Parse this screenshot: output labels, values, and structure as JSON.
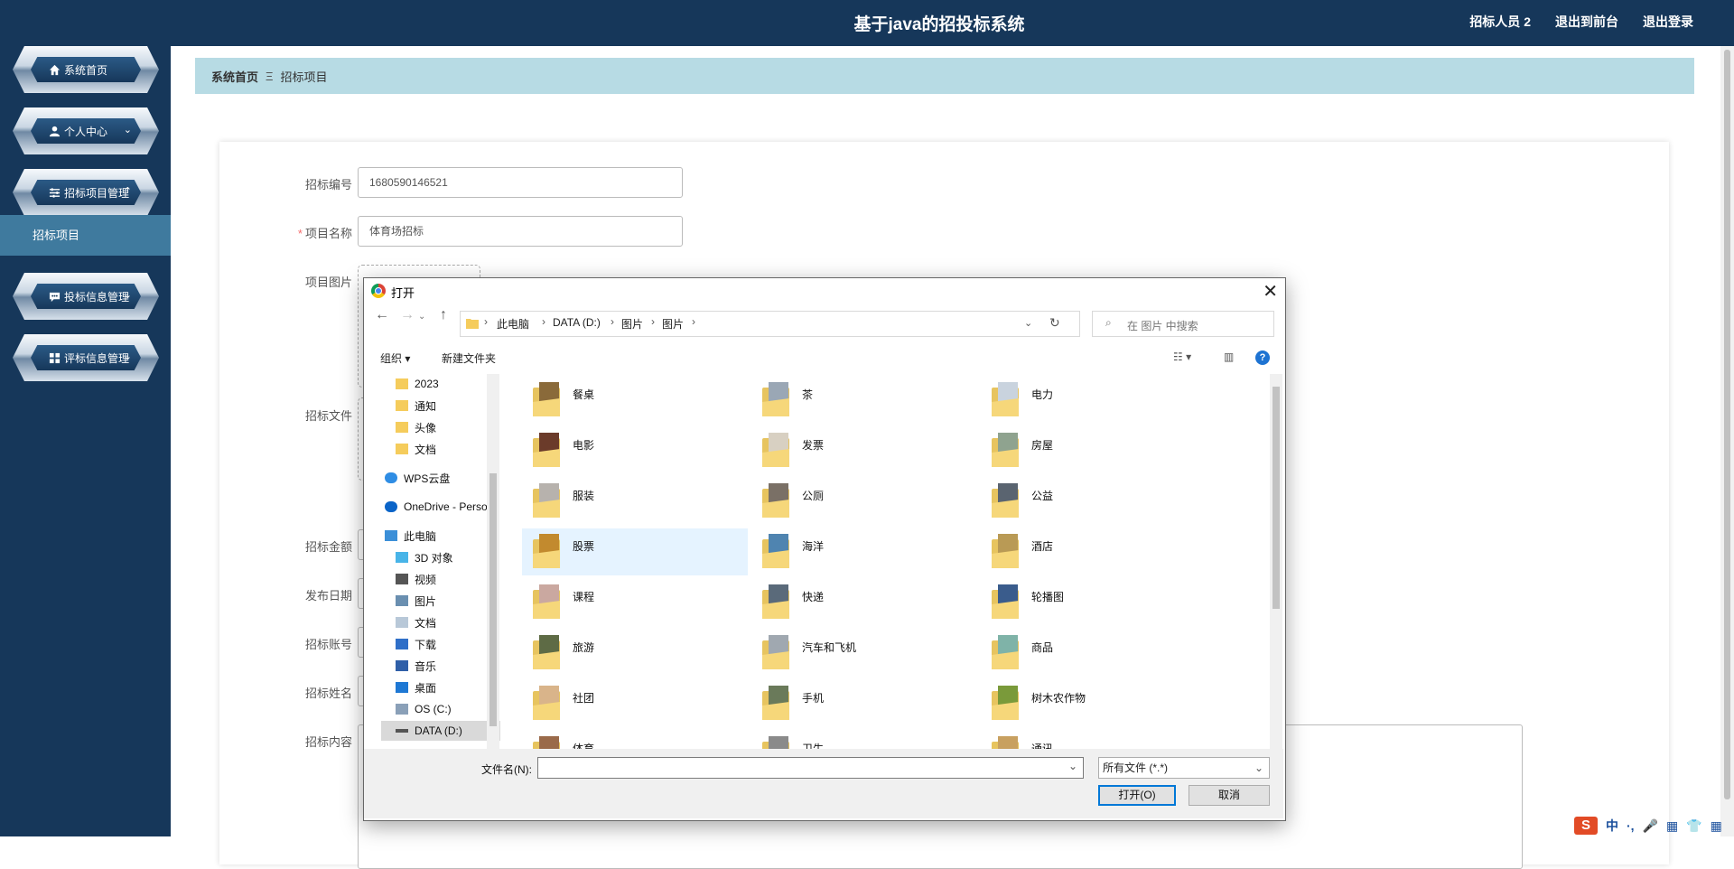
{
  "header": {
    "title": "基于java的招投标系统",
    "links": [
      "招标人员 2",
      "退出到前台",
      "退出登录"
    ]
  },
  "sidebar": {
    "items": [
      {
        "label": "系统首页",
        "icon": "home-icon",
        "chevron": ""
      },
      {
        "label": "个人中心",
        "icon": "user-icon",
        "chevron": "⌄"
      },
      {
        "label": "招标项目管理",
        "icon": "sliders-icon",
        "chevron": "⌃"
      },
      {
        "label": "投标信息管理",
        "icon": "chat-icon",
        "chevron": "⌄"
      },
      {
        "label": "评标信息管理",
        "icon": "grid-icon",
        "chevron": "⌄"
      }
    ],
    "submenu": "招标项目"
  },
  "breadcrumb": {
    "home": "系统首页",
    "separator": "Ξ",
    "current": "招标项目"
  },
  "form": {
    "fields": [
      {
        "label": "招标编号",
        "value": "1680590146521",
        "required": false
      },
      {
        "label": "项目名称",
        "value": "体育场招标",
        "required": true
      },
      {
        "label": "项目图片",
        "value": "",
        "required": false
      },
      {
        "label": "招标文件",
        "value": "",
        "required": false
      },
      {
        "label": "招标金额",
        "value": "",
        "required": false
      },
      {
        "label": "发布日期",
        "value": "",
        "required": false
      },
      {
        "label": "招标账号",
        "value": "",
        "required": false
      },
      {
        "label": "招标姓名",
        "value": "",
        "required": false
      },
      {
        "label": "招标内容",
        "value": "",
        "required": false
      }
    ],
    "required_mark": "*"
  },
  "dialog": {
    "title": "打开",
    "path": [
      "此电脑",
      "DATA (D:)",
      "图片",
      "图片"
    ],
    "search_placeholder": "在 图片 中搜索",
    "toolbar": {
      "organize": "组织 ▾",
      "new_folder": "新建文件夹"
    },
    "nav": [
      {
        "label": "2023",
        "type": "folder"
      },
      {
        "label": "通知",
        "type": "folder"
      },
      {
        "label": "头像",
        "type": "folder"
      },
      {
        "label": "文档",
        "type": "folder"
      },
      {
        "label": "WPS云盘",
        "type": "cloud"
      },
      {
        "label": "OneDrive - Perso",
        "type": "cloud"
      },
      {
        "label": "此电脑",
        "type": "pc"
      },
      {
        "label": "3D 对象",
        "type": "3d"
      },
      {
        "label": "视频",
        "type": "video"
      },
      {
        "label": "图片",
        "type": "picture"
      },
      {
        "label": "文档",
        "type": "doc"
      },
      {
        "label": "下载",
        "type": "download"
      },
      {
        "label": "音乐",
        "type": "music"
      },
      {
        "label": "桌面",
        "type": "desktop"
      },
      {
        "label": "OS (C:)",
        "type": "drive"
      },
      {
        "label": "DATA (D:)",
        "type": "drive"
      }
    ],
    "folders": [
      {
        "name": "餐桌",
        "color": "#8a6a3a"
      },
      {
        "name": "茶",
        "color": "#9aa7b5"
      },
      {
        "name": "电力",
        "color": "#c9d3de"
      },
      {
        "name": "电影",
        "color": "#6b3b2a"
      },
      {
        "name": "发票",
        "color": "#d8d0c2"
      },
      {
        "name": "房屋",
        "color": "#8fa38f"
      },
      {
        "name": "服装",
        "color": "#b7b2ad"
      },
      {
        "name": "公厕",
        "color": "#7a7066"
      },
      {
        "name": "公益",
        "color": "#5a6470"
      },
      {
        "name": "股票",
        "color": "#c28a2e"
      },
      {
        "name": "海洋",
        "color": "#4f84b0"
      },
      {
        "name": "酒店",
        "color": "#b99a55"
      },
      {
        "name": "课程",
        "color": "#caa8a0"
      },
      {
        "name": "快递",
        "color": "#5a6a7a"
      },
      {
        "name": "轮播图",
        "color": "#3a5c8c"
      },
      {
        "name": "旅游",
        "color": "#5e6b45"
      },
      {
        "name": "汽车和飞机",
        "color": "#a0a8b0"
      },
      {
        "name": "商品",
        "color": "#7fb3a8"
      },
      {
        "name": "社团",
        "color": "#d9b48a"
      },
      {
        "name": "手机",
        "color": "#6a7a5a"
      },
      {
        "name": "树木农作物",
        "color": "#7a9a3a"
      },
      {
        "name": "体育",
        "color": "#9a6a4a"
      },
      {
        "name": "卫生",
        "color": "#8a8a8a"
      },
      {
        "name": "通讯",
        "color": "#c8a060"
      }
    ],
    "filename_label": "文件名(N):",
    "filename_value": "",
    "filetype": "所有文件 (*.*)",
    "open_button": "打开(O)",
    "cancel_button": "取消"
  },
  "ime": {
    "logo": "S",
    "items": [
      "中",
      "·,",
      "🎤",
      "▦",
      "👕",
      "▦"
    ]
  }
}
